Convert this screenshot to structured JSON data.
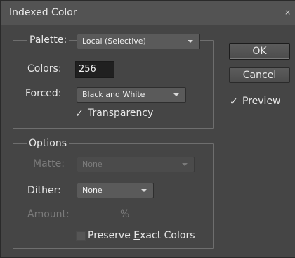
{
  "window": {
    "title": "Indexed Color",
    "close_glyph": "×"
  },
  "palette_group": {
    "palette_label": "Palette:",
    "palette_value": "Local (Selective)",
    "colors_label": "Colors:",
    "colors_value": "256",
    "forced_label": "Forced:",
    "forced_value": "Black and White",
    "transparency_label_prefix": "T",
    "transparency_label_rest": "ransparency",
    "transparency_checked": true
  },
  "options_group": {
    "title": "Options",
    "matte_label": "Matte:",
    "matte_value": "None",
    "dither_label": "Dither:",
    "dither_value": "None",
    "amount_label": "Amount:",
    "amount_unit": "%",
    "preserve_label_pre": "Preserve ",
    "preserve_label_mn": "E",
    "preserve_label_post": "xact Colors",
    "preserve_checked": false
  },
  "buttons": {
    "ok_label": "OK",
    "cancel_label": "Cancel"
  },
  "preview": {
    "label_mn": "P",
    "label_rest": "review",
    "checked": true
  },
  "icons": {
    "checkmark": "✓"
  }
}
